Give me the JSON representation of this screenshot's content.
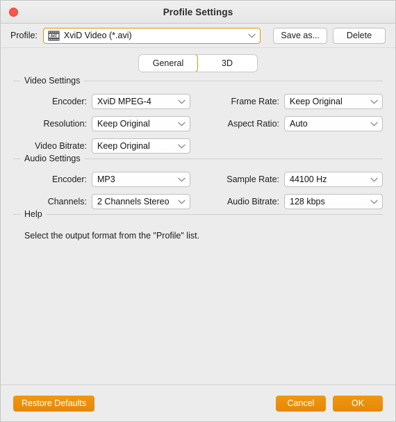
{
  "window": {
    "title": "Profile Settings",
    "close_icon": "close-traffic-light"
  },
  "profile_bar": {
    "label": "Profile:",
    "icon": "avi-film-icon",
    "value": "XviD Video (*.avi)",
    "save_as_label": "Save as...",
    "delete_label": "Delete"
  },
  "tabs": [
    {
      "label": "General",
      "active": true
    },
    {
      "label": "3D",
      "active": false
    }
  ],
  "video_settings": {
    "legend": "Video Settings",
    "fields": [
      {
        "label": "Encoder:",
        "value": "XviD MPEG-4"
      },
      {
        "label": "Frame Rate:",
        "value": "Keep Original"
      },
      {
        "label": "Resolution:",
        "value": "Keep Original"
      },
      {
        "label": "Aspect Ratio:",
        "value": "Auto"
      },
      {
        "label": "Video Bitrate:",
        "value": "Keep Original"
      }
    ]
  },
  "audio_settings": {
    "legend": "Audio Settings",
    "fields": [
      {
        "label": "Encoder:",
        "value": "MP3"
      },
      {
        "label": "Sample Rate:",
        "value": "44100 Hz"
      },
      {
        "label": "Channels:",
        "value": "2 Channels Stereo"
      },
      {
        "label": "Audio Bitrate:",
        "value": "128 kbps"
      }
    ]
  },
  "help": {
    "legend": "Help",
    "text": "Select the output format from the \"Profile\" list."
  },
  "footer": {
    "restore_label": "Restore Defaults",
    "cancel_label": "Cancel",
    "ok_label": "OK"
  },
  "colors": {
    "accent_orange": "#E5880A",
    "close_red": "#F9564C",
    "window_bg": "#ECECEC"
  }
}
